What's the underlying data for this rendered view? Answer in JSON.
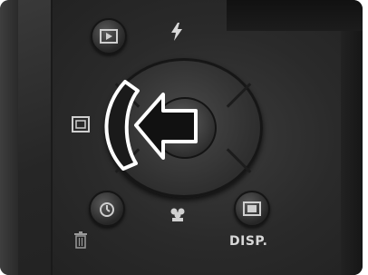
{
  "labels": {
    "disp": "DISP."
  },
  "icons": {
    "playback": "playback-icon",
    "flash": "flash-icon",
    "exposure": "exposure-compensation-icon",
    "self_timer": "self-timer-icon",
    "macro": "macro-flower-icon",
    "display": "display-icon",
    "trash": "trash-icon",
    "highlight_arrow": "left-arrow-icon",
    "highlight_bracket": "curved-bracket-icon"
  },
  "colors": {
    "body": "#2a2a2a",
    "icon": "#cfcfcf",
    "overlay_fill": "#111111",
    "overlay_stroke": "#ffffff"
  }
}
